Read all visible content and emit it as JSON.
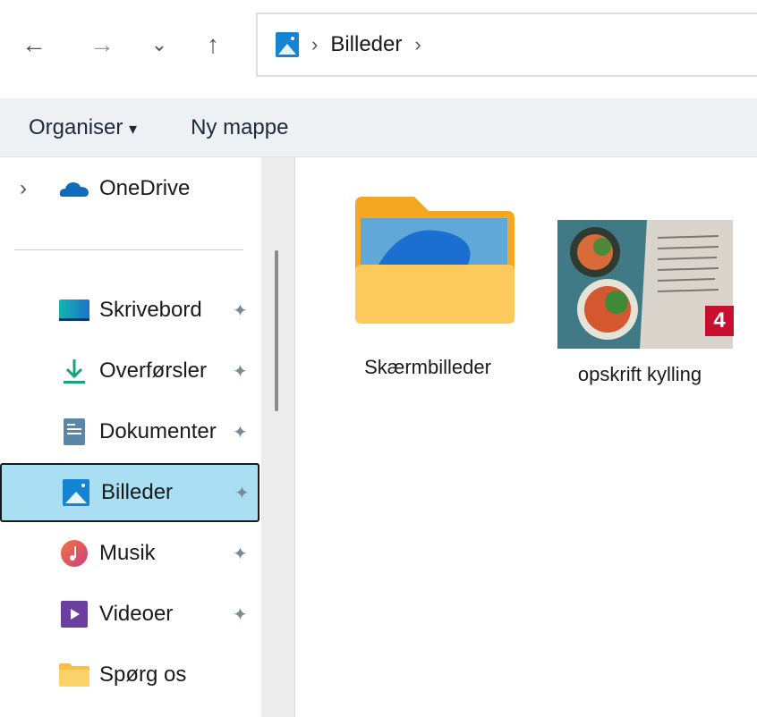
{
  "nav": {
    "back": "←",
    "forward": "→",
    "recent": "⌄",
    "up": "↑"
  },
  "address": {
    "sep1": "›",
    "location": "Billeder",
    "sep2": "›"
  },
  "toolbar": {
    "organise": "Organiser",
    "organise_caret": "▾",
    "new_folder": "Ny mappe"
  },
  "sidebar": {
    "onedrive": {
      "expand": "›",
      "label": "OneDrive"
    },
    "items": [
      {
        "label": "Skrivebord",
        "pinned": true
      },
      {
        "label": "Overførsler",
        "pinned": true
      },
      {
        "label": "Dokumenter",
        "pinned": true
      },
      {
        "label": "Billeder",
        "pinned": true,
        "selected": true
      },
      {
        "label": "Musik",
        "pinned": true
      },
      {
        "label": "Videoer",
        "pinned": true
      },
      {
        "label": "Spørg os",
        "pinned": false
      }
    ],
    "pin_glyph": "📌"
  },
  "files": [
    {
      "name": "Skærmbilleder",
      "type": "folder"
    },
    {
      "name": "opskrift kylling",
      "type": "image"
    }
  ],
  "badge": "4",
  "colors": {
    "selected": "#a9def3",
    "badge": "#c8102e",
    "toolbar": "#eef1f4"
  }
}
